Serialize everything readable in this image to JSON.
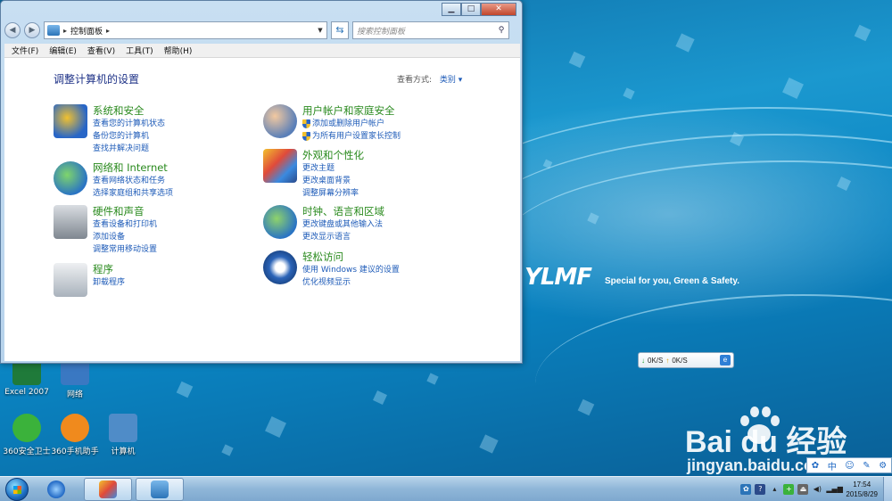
{
  "window": {
    "address": {
      "crumb": "控制面板"
    },
    "search_placeholder": "搜索控制面板",
    "menu": [
      "文件(F)",
      "编辑(E)",
      "查看(V)",
      "工具(T)",
      "帮助(H)"
    ],
    "content_title": "调整计算机的设置",
    "view_by_label": "查看方式:",
    "view_by_value": "类别 ▾",
    "categories": [
      {
        "title": "系统和安全",
        "links": [
          "查看您的计算机状态",
          "备份您的计算机",
          "查找并解决问题"
        ]
      },
      {
        "title": "网络和 Internet",
        "links": [
          "查看网络状态和任务",
          "选择家庭组和共享选项"
        ]
      },
      {
        "title": "硬件和声音",
        "links": [
          "查看设备和打印机",
          "添加设备",
          "调整常用移动设置"
        ]
      },
      {
        "title": "程序",
        "links": [
          "卸载程序"
        ]
      },
      {
        "title": "用户帐户和家庭安全",
        "links": [
          "添加或删除用户帐户",
          "为所有用户设置家长控制"
        ]
      },
      {
        "title": "外观和个性化",
        "links": [
          "更改主题",
          "更改桌面背景",
          "调整屏幕分辨率"
        ]
      },
      {
        "title": "时钟、语言和区域",
        "links": [
          "更改键盘或其他输入法",
          "更改显示语言"
        ]
      },
      {
        "title": "轻松访问",
        "links": [
          "使用 Windows 建议的设置",
          "优化视频显示"
        ]
      }
    ]
  },
  "desktop": {
    "icons": [
      {
        "label": "Excel 2007",
        "color": "#1f7a3a"
      },
      {
        "label": "网络",
        "color": "#3a78c2"
      },
      {
        "label": "360安全卫士",
        "color": "#3bb23b"
      },
      {
        "label": "360手机助手",
        "color": "#f08a1d"
      },
      {
        "label": "计算机",
        "color": "#4f8cc8"
      }
    ],
    "brand": "YLMF",
    "brand_tagline": "Special for you, Green & Safety.",
    "netspeed": {
      "down": "0K/S",
      "up": "0K/S"
    },
    "watermark": {
      "brand": "Bai  du 经验",
      "url": "jingyan.baidu.com"
    },
    "ime": [
      "中",
      "☺",
      "✎",
      "⚙"
    ]
  },
  "taskbar": {
    "time": "17:54",
    "date": "2015/8/29"
  }
}
